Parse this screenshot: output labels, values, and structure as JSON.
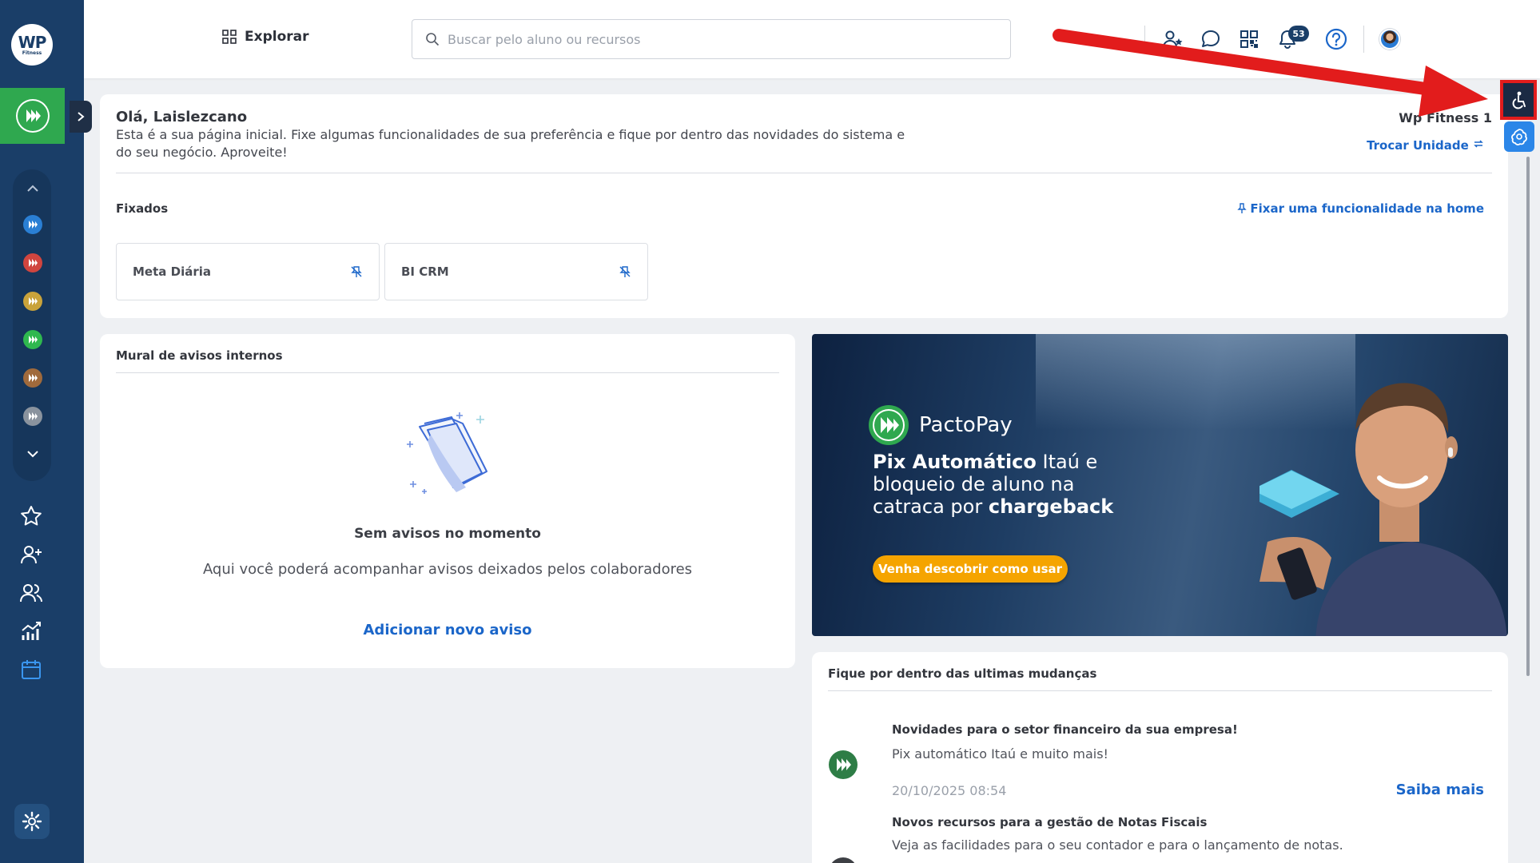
{
  "app": {
    "logo_text": "WP",
    "logo_sub": "Fitness"
  },
  "header": {
    "explore_label": "Explorar",
    "search_placeholder": "Buscar pelo aluno ou recursos",
    "notifications_count": "53"
  },
  "home": {
    "greeting": "Olá, Laislezcano",
    "intro": "Esta é a sua página inicial. Fixe algumas funcionalidades de sua preferência e fique por dentro das novidades do sistema e do seu negócio. Aproveite!",
    "unit_name": "Wp Fitness 1",
    "switch_unit": "Trocar Unidade",
    "pinned_title": "Fixados",
    "pin_link": "Fixar uma funcionalidade na home",
    "pinned": [
      {
        "label": "Meta Diária"
      },
      {
        "label": "BI CRM"
      }
    ]
  },
  "mural": {
    "title": "Mural de avisos internos",
    "empty_title": "Sem avisos no momento",
    "empty_desc": "Aqui você poderá acompanhar avisos deixados pelos colaboradores",
    "add_label": "Adicionar novo aviso"
  },
  "banner": {
    "brand": "PactoPay",
    "headline_bold1": "Pix Automático",
    "headline_1": " Itaú e bloqueio de aluno na catraca por ",
    "headline_bold2": "chargeback",
    "cta": "Venha descobrir como usar"
  },
  "news": {
    "title": "Fique por dentro das ultimas mudanças",
    "items": [
      {
        "title": "Novidades para o setor financeiro da sua empresa!",
        "desc": "Pix automático Itaú e muito mais!",
        "date": "20/10/2025 08:54",
        "more": "Saiba mais"
      },
      {
        "title": "Novos recursos para a gestão de Notas Fiscais",
        "desc": "Veja as facilidades para o seu contador e para o lançamento de notas."
      }
    ]
  },
  "colors": {
    "sidebar": "#1a3e68",
    "accent_green": "#2fa84f",
    "link_blue": "#1b66c9",
    "annotation_red": "#e21c1c",
    "cta_orange": "#f5a400"
  },
  "icons": {
    "sidebar_units": [
      "pacto-blue-icon",
      "pacto-red-icon",
      "pacto-gold-icon",
      "pacto-green-icon",
      "pacto-brown-icon",
      "pacto-gray-icon"
    ],
    "sidebar_nav": [
      "star-icon",
      "add-user-icon",
      "users-icon",
      "chart-icon",
      "calendar-icon",
      "gear-icon"
    ],
    "topbar": [
      "grid-icon",
      "search-icon",
      "add-user-icon",
      "chat-icon",
      "qr-icon",
      "bell-icon",
      "help-icon"
    ],
    "right_edge": [
      "accessibility-icon",
      "ai-assistant-icon"
    ]
  }
}
